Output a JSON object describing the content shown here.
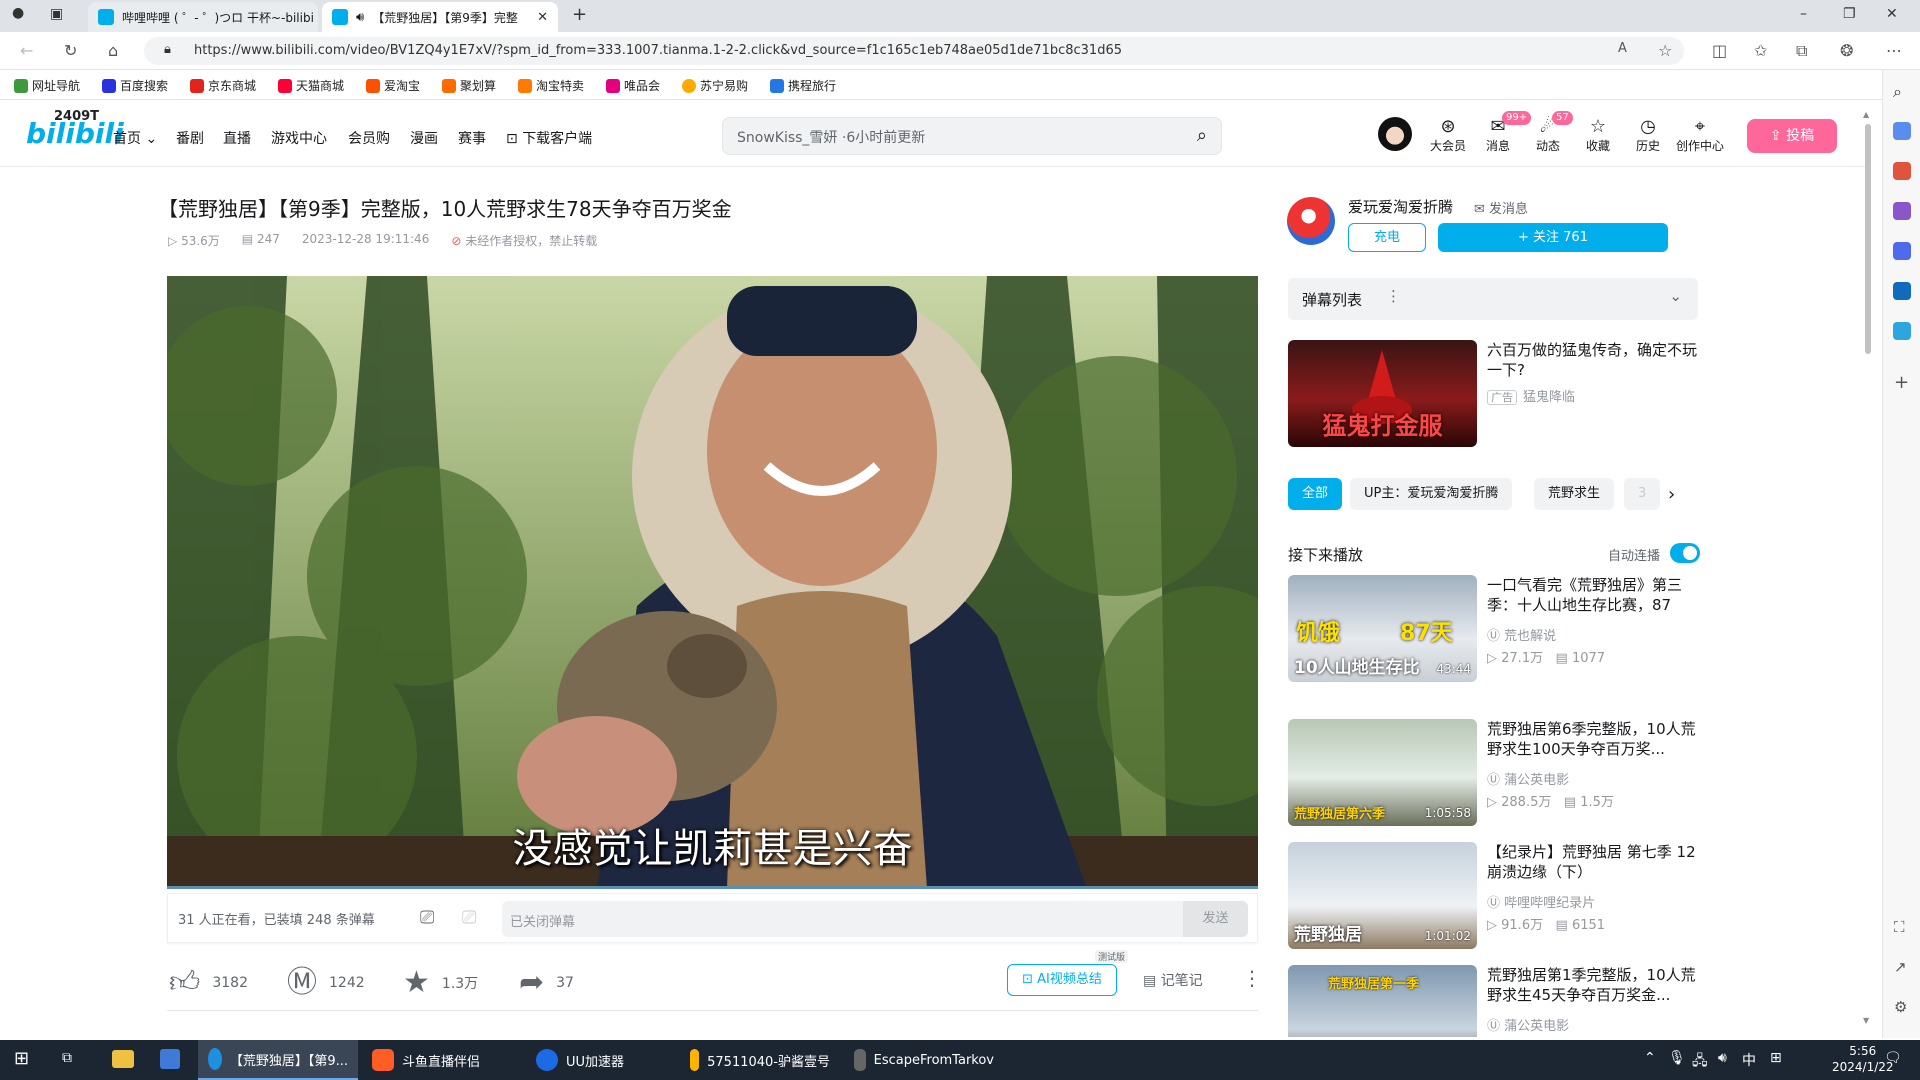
{
  "browser": {
    "tabs": [
      {
        "label": "哔哩哔哩 ( ゜- ゜)つロ 干杯~-bilibi",
        "active": false
      },
      {
        "label": "【荒野独居】【第9季】完整",
        "active": true
      }
    ],
    "new_tab": "+",
    "url": "https://www.bilibili.com/video/BV1ZQ4y1E7xV/?spm_id_from=333.1007.tianma.1-2-2.click&vd_source=f1c165c1eb748ae05d1de71bc8c31d65",
    "window_controls": {
      "minimize": "–",
      "restore": "❐",
      "close": "✕"
    }
  },
  "bookmarks": [
    {
      "label": "网址导航",
      "color": "#3c9a3c"
    },
    {
      "label": "百度搜索",
      "color": "#2932e1"
    },
    {
      "label": "京东商城",
      "color": "#e1251b"
    },
    {
      "label": "天猫商城",
      "color": "#ff0036"
    },
    {
      "label": "爱淘宝",
      "color": "#ff5000"
    },
    {
      "label": "聚划算",
      "color": "#ff6a00"
    },
    {
      "label": "淘宝特卖",
      "color": "#ff7a00"
    },
    {
      "label": "唯品会",
      "color": "#e4007f"
    },
    {
      "label": "苏宁易购",
      "color": "#ffaa00"
    },
    {
      "label": "携程旅行",
      "color": "#2577e3"
    }
  ],
  "header": {
    "logo": "bilibili",
    "logo_overlay": "2409T",
    "nav": [
      "首页",
      "番剧",
      "直播",
      "游戏中心",
      "会员购",
      "漫画",
      "赛事",
      "下载客户端"
    ],
    "search_placeholder": "SnowKiss_雪妍 ·6小时前更新",
    "icons": [
      {
        "label": "大会员",
        "glyph": "⊛",
        "badge": ""
      },
      {
        "label": "消息",
        "glyph": "✉",
        "badge": "99+"
      },
      {
        "label": "动态",
        "glyph": "☄",
        "badge": "57"
      },
      {
        "label": "收藏",
        "glyph": "☆",
        "badge": ""
      },
      {
        "label": "历史",
        "glyph": "◷",
        "badge": ""
      },
      {
        "label": "创作中心",
        "glyph": "⌖",
        "badge": ""
      }
    ],
    "upload_label": "投稿",
    "accent": "#00aeec",
    "pink": "#ff6699"
  },
  "video": {
    "title": "【荒野独居】【第9季】完整版，10人荒野求生78天争夺百万奖金",
    "views": "53.6万",
    "danmaku": "247",
    "date": "2023-12-28 19:11:46",
    "notice": "未经作者授权，禁止转载",
    "subtitle": "没感觉让凯莉甚是兴奋",
    "watching": "31 人正在看，已装填 248 条弹幕",
    "danmaku_placeholder": "已关闭弹幕",
    "send": "发送",
    "likes": "3182",
    "coins": "1242",
    "favorites": "1.3万",
    "shares": "37",
    "ai_summary": "AI视频总结",
    "test_tag": "测试版",
    "notes": "记笔记"
  },
  "uploader": {
    "name": "爱玩爱淘爱折腾",
    "message": "发消息",
    "charge": "充电",
    "follow": "+ 关注 761"
  },
  "danmaku_list": {
    "title": "弹幕列表"
  },
  "ad": {
    "title": "六百万做的猛鬼传奇，确定不玩一下?",
    "tag": "广告",
    "advertiser": "猛鬼降临",
    "thumb_text": "猛鬼打金服"
  },
  "tags": [
    "全部",
    "UP主：爱玩爱淘爱折腾",
    "荒野求生",
    "3"
  ],
  "up_next": {
    "title": "接下来播放",
    "autoplay": "自动连播"
  },
  "recommendations": [
    {
      "title": "一口气看完《荒野独居》第三季：十人山地生存比赛，87天...",
      "uploader": "荒也解说",
      "views": "27.1万",
      "danmaku": "1077",
      "duration": "43:44",
      "caption": "10人山地生存比",
      "badge1": "饥饿",
      "badge2": "87天"
    },
    {
      "title": "荒野独居第6季完整版，10人荒野求生100天争夺百万奖...",
      "uploader": "蒲公英电影",
      "views": "288.5万",
      "danmaku": "1.5万",
      "duration": "1:05:58",
      "caption": "荒野独居第六季"
    },
    {
      "title": "【纪录片】荒野独居 第七季 12 崩溃边缘（下）",
      "uploader": "哔哩哔哩纪录片",
      "views": "91.6万",
      "danmaku": "6151",
      "duration": "1:01:02",
      "caption": "荒野独居"
    },
    {
      "title": "荒野独居第1季完整版，10人荒野求生45天争夺百万奖金...",
      "uploader": "蒲公英电影",
      "views": "",
      "danmaku": "",
      "duration": "",
      "caption": "荒野独居第一季"
    }
  ],
  "taskbar": {
    "items": [
      {
        "label": "【荒野独居】【第9...",
        "color": "#1f8fe0",
        "active": true
      },
      {
        "label": "斗鱼直播伴侣",
        "color": "#ff5d23",
        "active": false
      },
      {
        "label": "UU加速器",
        "color": "#1d6ae5",
        "active": false
      },
      {
        "label": "57511040-驴酱壹号",
        "color": "#ffb400",
        "active": false
      },
      {
        "label": "EscapeFromTarkov",
        "color": "#666",
        "active": false
      }
    ],
    "ime": "中",
    "time": "5:56",
    "date": "2024/1/22"
  }
}
